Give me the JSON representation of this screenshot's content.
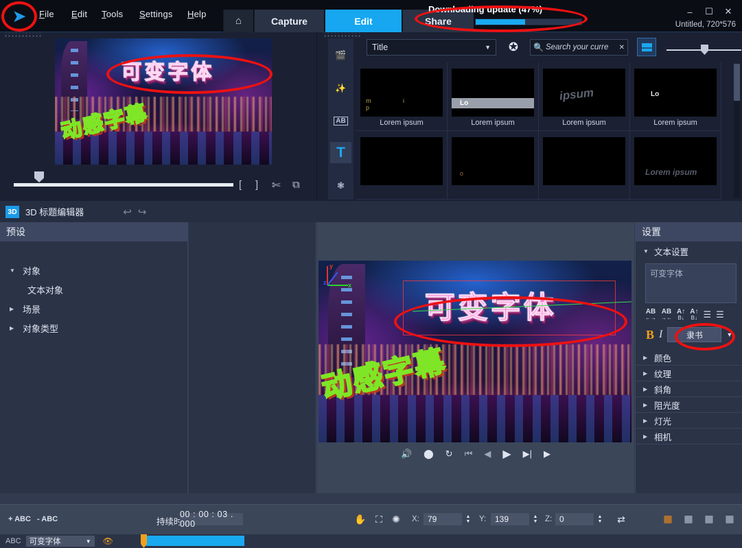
{
  "app": {
    "logo_icon": "play-chevron-logo",
    "menus": [
      "File",
      "Edit",
      "Tools",
      "Settings",
      "Help"
    ],
    "modes": [
      {
        "label": "",
        "icon": "home-icon",
        "active": false
      },
      {
        "label": "Capture",
        "active": false
      },
      {
        "label": "Edit",
        "active": true
      },
      {
        "label": "Share",
        "active": false
      }
    ],
    "update": {
      "text": "Downloading update (47%)",
      "percent": 47,
      "accent": "#19a9f0"
    },
    "window_controls": [
      "minimize-icon",
      "maximize-icon",
      "close-icon"
    ],
    "document_label": "Untitled, 720*576"
  },
  "preview": {
    "video_text_top": "可变字体",
    "video_text_bottom": "动感字幕",
    "icons": [
      "mark-in-icon",
      "mark-out-icon",
      "split-scissors-icon",
      "snapshot-icon"
    ]
  },
  "library": {
    "rail": [
      {
        "name": "media-library-icon",
        "selected": false
      },
      {
        "name": "effects-icon",
        "selected": false
      },
      {
        "name": "transitions-ab-icon",
        "label": "AB",
        "selected": false
      },
      {
        "name": "title-icon",
        "label": "T",
        "selected": true
      },
      {
        "name": "particle-icon",
        "selected": false
      }
    ],
    "category": "Title",
    "search_placeholder": "Search your curre",
    "thumbnails": [
      {
        "caption": "Lorem ipsum",
        "style": "tp1"
      },
      {
        "caption": "Lorem ipsum",
        "style": "tp2",
        "inner": "Lo"
      },
      {
        "caption": "Lorem ipsum",
        "style": "tp3",
        "inner": "ipsum"
      },
      {
        "caption": "Lorem ipsum",
        "style": "tp4",
        "inner": "Lo"
      },
      {
        "caption": "",
        "style": "blank"
      },
      {
        "caption": "",
        "style": "tp5",
        "inner": "o"
      },
      {
        "caption": "",
        "style": "blank"
      },
      {
        "caption": "",
        "style": "tp6",
        "inner": "Lorem ipsum"
      }
    ]
  },
  "title_editor": {
    "badge": "3D",
    "title": "3D 标题编辑器",
    "undo_icon": "undo-arrow-icon",
    "redo_icon": "redo-arrow-icon",
    "presets": {
      "header": "预设",
      "items": [
        {
          "label": "对象",
          "expanded": true,
          "child": false
        },
        {
          "label": "文本对象",
          "expanded": null,
          "child": true
        },
        {
          "label": "场景",
          "expanded": false,
          "child": false
        },
        {
          "label": "对象类型",
          "expanded": false,
          "child": false
        }
      ]
    },
    "canvas": {
      "axis_labels": {
        "x": "x",
        "y": "y",
        "z": "z"
      },
      "axis_colors": {
        "x": "#2ad42a",
        "y": "#e8332a",
        "z": "#2f5ce8"
      },
      "text_top": "可变字体",
      "text_bottom": "动感字幕"
    },
    "player_controls": [
      "audio-icon",
      "volume-icon",
      "loop-icon",
      "prev-frame-icon",
      "step-back-icon",
      "play-icon",
      "step-forward-icon",
      "next-frame-icon"
    ],
    "settings": {
      "header": "设置",
      "text_settings_label": "文本设置",
      "text_value": "可变字体",
      "format_icons": [
        {
          "name": "letter-spacing-expand-icon",
          "top": "AB",
          "bottom": "←→"
        },
        {
          "name": "letter-spacing-contract-icon",
          "top": "AB",
          "bottom": "→←"
        },
        {
          "name": "line-spacing-increase-icon",
          "top": "A↑",
          "bottom": "B↓"
        },
        {
          "name": "line-spacing-decrease-icon",
          "top": "A↑",
          "bottom": "B↓"
        },
        {
          "name": "align-left-icon",
          "top": "≡",
          "bottom": ""
        },
        {
          "name": "align-center-icon",
          "top": "≡",
          "bottom": ""
        }
      ],
      "bold_label": "B",
      "italic_label": "I",
      "font_name": "隶书",
      "groups": [
        "颜色",
        "纹理",
        "斜角",
        "阻光度",
        "灯光",
        "相机"
      ]
    }
  },
  "bottom_bar": {
    "add_text_label": "+ ABC",
    "remove_text_label": "- ABC",
    "duration_label": "持续时间",
    "duration_value": "00 : 00 : 03 . 000",
    "tools": [
      "hand-pan-icon",
      "move-object-icon",
      "rotate-object-icon"
    ],
    "coords": [
      {
        "label": "X:",
        "value": "79"
      },
      {
        "label": "Y:",
        "value": "139"
      },
      {
        "label": "Z:",
        "value": "0"
      }
    ],
    "reset_icon": "swap-reset-icon",
    "view_buttons": [
      {
        "name": "view-front-icon",
        "active": true
      },
      {
        "name": "view-top-icon",
        "active": false
      },
      {
        "name": "view-side-icon",
        "active": false
      },
      {
        "name": "view-perspective-icon",
        "active": false
      }
    ]
  },
  "track": {
    "type_label": "ABC",
    "clip_name": "可变字体",
    "eye_icon": "visibility-eye-icon",
    "clip_color": "#19a9f0"
  }
}
